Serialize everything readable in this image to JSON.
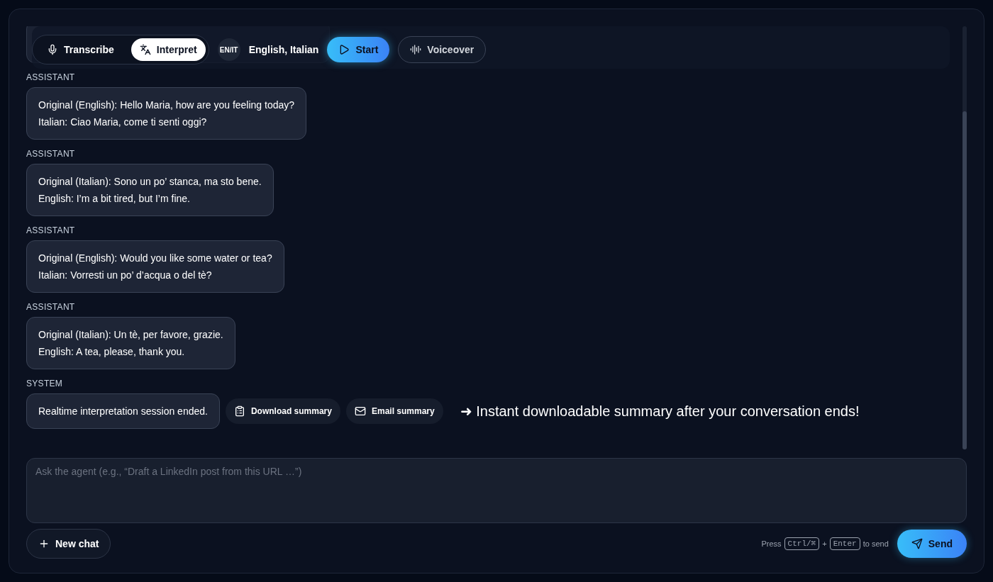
{
  "toolbar": {
    "modes": [
      {
        "label": "Transcribe",
        "kind": "mic",
        "selected": false
      },
      {
        "label": "Interpret",
        "kind": "translate",
        "selected": true
      }
    ],
    "language_badge": "EN/IT",
    "languages": "English, Italian",
    "actions": [
      {
        "label": "Start",
        "kind": "primary"
      },
      {
        "label": "Voiceover",
        "kind": "outline"
      }
    ]
  },
  "messages": [
    {
      "role": "ASSISTANT",
      "lines": [
        "Original (English): Hello Maria, how are you feeling today?",
        "Italian: Ciao Maria, come ti senti oggi?"
      ]
    },
    {
      "role": "ASSISTANT",
      "lines": [
        "Original (Italian): Sono un po’ stanca, ma sto bene.",
        "English: I’m a bit tired, but I’m fine."
      ]
    },
    {
      "role": "ASSISTANT",
      "lines": [
        "Original (English): Would you like some water or tea?",
        "Italian: Vorresti un po’ d’acqua o del tè?"
      ]
    },
    {
      "role": "ASSISTANT",
      "lines": [
        "Original (Italian): Un tè, per favore, grazie.",
        "English: A tea, please, thank you."
      ]
    },
    {
      "role": "SYSTEM",
      "lines": [
        "Realtime interpretation session ended."
      ],
      "actions": [
        {
          "label": "Download summary",
          "kind": "download"
        },
        {
          "label": "Email summary",
          "kind": "email"
        }
      ]
    }
  ],
  "annotation": "➜ Instant downloadable summary after your conversation ends!",
  "composer": {
    "placeholder": "Ask the agent (e.g., “Draft a LinkedIn post from this URL …”)"
  },
  "new_chat": "New chat",
  "hint": {
    "before": "Press",
    "key1": "Ctrl/⌘",
    "plus": "+",
    "key2": "Enter",
    "after": "to send"
  },
  "send": "Send"
}
